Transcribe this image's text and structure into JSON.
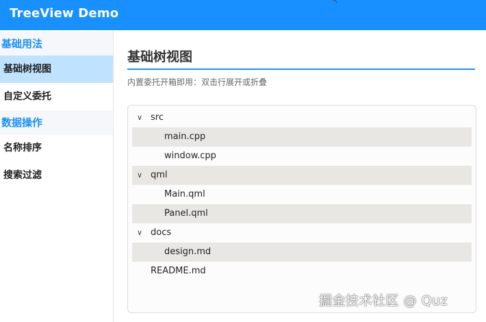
{
  "app": {
    "title": "TreeView Demo"
  },
  "sidebar": {
    "groups": [
      {
        "title": "基础用法",
        "items": [
          {
            "label": "基础树视图",
            "active": true
          },
          {
            "label": "自定义委托",
            "active": false
          }
        ]
      },
      {
        "title": "数据操作",
        "items": [
          {
            "label": "名称排序",
            "active": false
          },
          {
            "label": "搜索过滤",
            "active": false
          }
        ]
      }
    ]
  },
  "main": {
    "title": "基础树视图",
    "subtitle": "内置委托开箱即用：双击行展开或折叠",
    "tree": [
      {
        "label": "src",
        "expanded": true,
        "level": 0,
        "icon": "chevron-down-icon"
      },
      {
        "label": "main.cpp",
        "level": 1
      },
      {
        "label": "window.cpp",
        "level": 1
      },
      {
        "label": "qml",
        "expanded": true,
        "level": 0,
        "icon": "chevron-down-icon"
      },
      {
        "label": "Main.qml",
        "level": 1
      },
      {
        "label": "Panel.qml",
        "level": 1
      },
      {
        "label": "docs",
        "expanded": true,
        "level": 0,
        "icon": "chevron-down-icon"
      },
      {
        "label": "design.md",
        "level": 1
      },
      {
        "label": "README.md",
        "level": 0
      }
    ]
  },
  "watermark": {
    "text": "掘金技术社区 @ Quz"
  },
  "colors": {
    "accent": "#1890ff",
    "active_item_bg": "#bfe3ff",
    "alt_row_bg": "#e9e7e4",
    "group_bg": "#f5f7fa"
  }
}
